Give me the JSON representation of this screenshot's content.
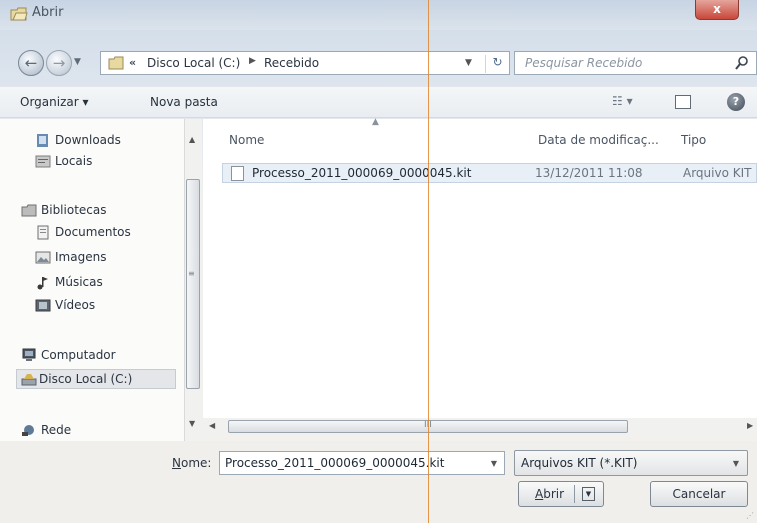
{
  "window": {
    "title": "Abrir",
    "close_glyph": "x"
  },
  "nav": {
    "back_glyph": "←",
    "forward_glyph": "→",
    "recent_glyph": "▼",
    "address": {
      "prefix": "«",
      "crumbs": [
        "Disco Local (C:)",
        "Recebido"
      ],
      "separator": "▶",
      "dropdown_glyph": "▼",
      "refresh_glyph": "↻"
    },
    "search": {
      "placeholder": "Pesquisar Recebido",
      "icon": "search-icon"
    }
  },
  "toolbar": {
    "organizar": "Organizar ▾",
    "nova_pasta": "Nova pasta",
    "views_glyph": "☷ ▾",
    "help_glyph": "?"
  },
  "sidebar": {
    "items": [
      {
        "label": "Downloads",
        "icon": "downloads-icon"
      },
      {
        "label": "Locais",
        "icon": "places-icon"
      },
      {
        "label": "Bibliotecas",
        "icon": "libraries-icon"
      },
      {
        "label": "Documentos",
        "icon": "documents-icon"
      },
      {
        "label": "Imagens",
        "icon": "images-icon"
      },
      {
        "label": "Músicas",
        "icon": "music-icon"
      },
      {
        "label": "Vídeos",
        "icon": "videos-icon"
      },
      {
        "label": "Computador",
        "icon": "computer-icon"
      },
      {
        "label": "Disco Local (C:)",
        "icon": "drive-icon",
        "selected": true
      },
      {
        "label": "Rede",
        "icon": "network-icon"
      }
    ]
  },
  "filelist": {
    "columns": [
      "Nome",
      "Data de modificaç...",
      "Tipo"
    ],
    "rows": [
      {
        "name": "Processo_2011_000069_0000045.kit",
        "date": "13/12/2011 11:08",
        "type": "Arquivo KIT"
      }
    ]
  },
  "scrollbar": {
    "up": "▲",
    "down": "▼",
    "left": "◀",
    "right": "▶",
    "grip": "≡",
    "hgrip": "III"
  },
  "footer": {
    "name_label_accel": "N",
    "name_label_rest": "ome:",
    "name_value": "Processo_2011_000069_0000045.kit",
    "filter_value": "Arquivos KIT (*.KIT)",
    "dropdown_glyph": "▼",
    "open_accel": "A",
    "open_rest": "brir",
    "open_split_glyph": "▼",
    "cancel_label": "Cancelar",
    "resize_grip": "⋰"
  },
  "colors": {
    "accent": "#e0852e",
    "selection": "#e9eff6",
    "close": "#c9473a"
  }
}
